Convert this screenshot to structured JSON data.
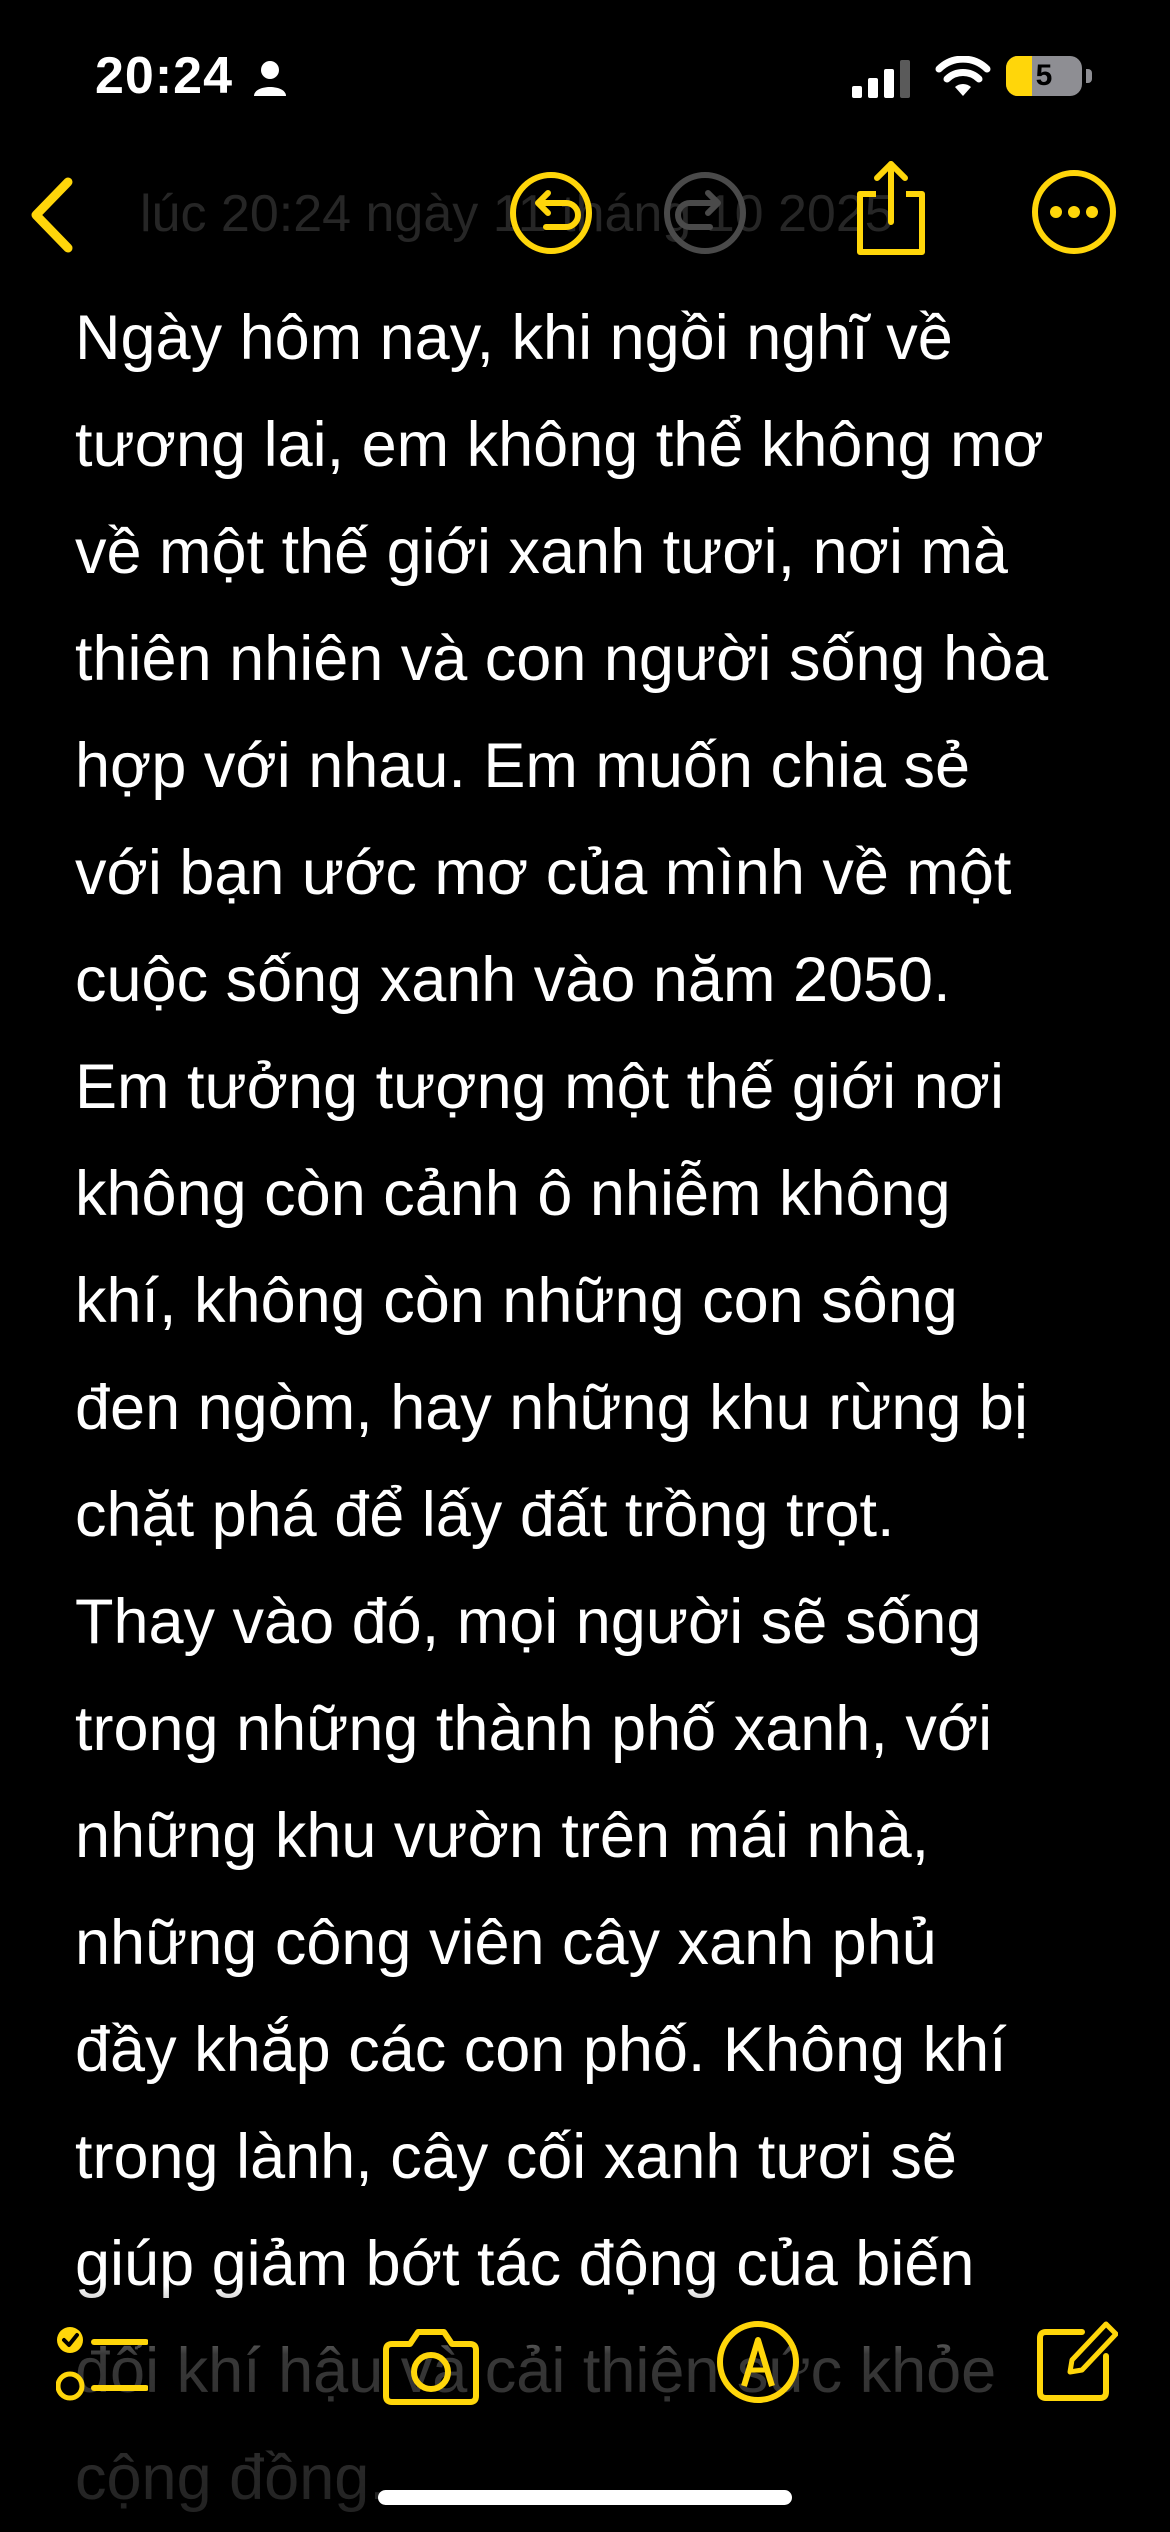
{
  "status_bar": {
    "time": "20:24",
    "battery": "5",
    "icons": [
      "person-icon",
      "cellular-signal-icon",
      "wifi-icon",
      "battery-icon"
    ]
  },
  "nav": {
    "ghost_title": "lúc 20:24 ngày 11 tháng 10 2025",
    "icons": [
      "chevron-left-icon",
      "undo-icon",
      "redo-icon",
      "share-icon",
      "more-icon"
    ],
    "accent_color": "#ffd60a",
    "disabled_color": "#4a4a4a"
  },
  "note": {
    "text": "Ngày hôm nay, khi ngồi nghĩ về\ntương lai, em không thể không mơ\nvề một thế giới xanh tươi, nơi mà\nthiên nhiên và con người sống hòa\nhợp với nhau. Em muốn chia sẻ\nvới bạn ước mơ của mình về một\ncuộc sống xanh vào năm 2050.\nEm tưởng tượng một thế giới nơi\nkhông còn cảnh ô nhiễm không\nkhí, không còn những con sông\nđen ngòm, hay những khu rừng bị\nchặt phá để lấy đất trồng trọt.\nThay vào đó, mọi người sẽ sống\ntrong những thành phố xanh, với\nnhững khu vườn trên mái nhà,\nnhững công viên cây xanh phủ\nđầy khắp các con phố. Không khí\ntrong lành, cây cối xanh tươi sẽ\ngiúp giảm bớt tác động của biến\nđổi khí hậu và cải thiện sức khỏe\ncộng đồng."
  },
  "toolbar": {
    "icons": [
      "checklist-icon",
      "camera-icon",
      "markup-icon",
      "compose-icon"
    ]
  }
}
